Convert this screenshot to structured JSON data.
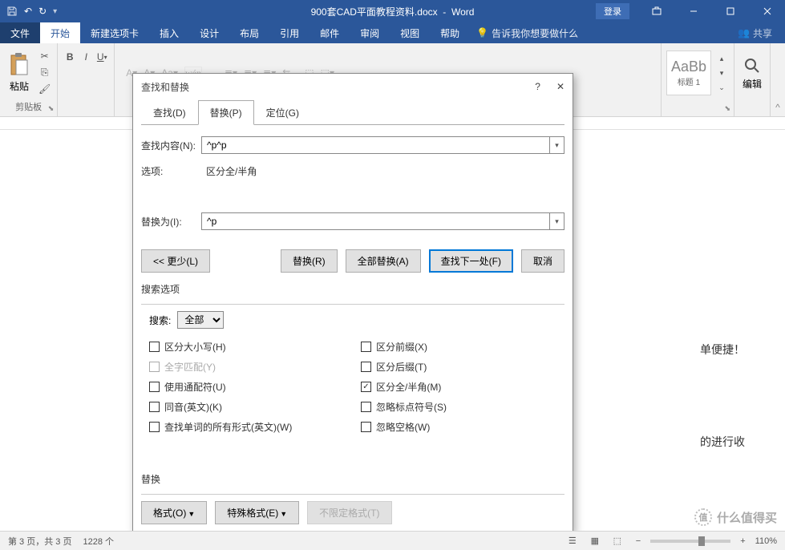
{
  "title": {
    "doc": "900套CAD平面教程资料.docx",
    "app": "Word"
  },
  "login": "登录",
  "menu": {
    "file": "文件",
    "home": "开始",
    "newtab": "新建选项卡",
    "insert": "插入",
    "design": "设计",
    "layout": "布局",
    "references": "引用",
    "mailings": "邮件",
    "review": "审阅",
    "view": "视图",
    "help": "帮助",
    "tellme": "告诉我你想要做什么",
    "share": "共享"
  },
  "ribbon": {
    "clipboard": "剪贴板",
    "paste": "粘贴",
    "style_preview": "AaBb",
    "style_name": "标题 1",
    "edit": "编辑"
  },
  "dialog": {
    "title": "查找和替换",
    "tabs": {
      "find": "查找(D)",
      "replace": "替换(P)",
      "goto": "定位(G)"
    },
    "find_label": "查找内容(N):",
    "find_value": "^p^p",
    "options_label": "选项:",
    "options_value": "区分全/半角",
    "replace_label": "替换为(I):",
    "replace_value": "^p",
    "less": "<< 更少(L)",
    "replace_btn": "替换(R)",
    "replace_all": "全部替换(A)",
    "find_next": "查找下一处(F)",
    "cancel": "取消",
    "search_options": "搜索选项",
    "search_label": "搜索:",
    "search_value": "全部",
    "checks_left": [
      "区分大小写(H)",
      "全字匹配(Y)",
      "使用通配符(U)",
      "同音(英文)(K)",
      "查找单词的所有形式(英文)(W)"
    ],
    "checks_right": [
      "区分前缀(X)",
      "区分后缀(T)",
      "区分全/半角(M)",
      "忽略标点符号(S)",
      "忽略空格(W)"
    ],
    "replace_section": "替换",
    "format": "格式(O)",
    "special": "特殊格式(E)",
    "noformat": "不限定格式(T)"
  },
  "doc": {
    "line1": "单便捷！",
    "line2": "的进行收"
  },
  "status": {
    "page": "第 3 页，共 3 页",
    "words": "1228 个",
    "zoom": "110%"
  },
  "watermark": {
    "char": "值",
    "text": "什么值得买"
  }
}
